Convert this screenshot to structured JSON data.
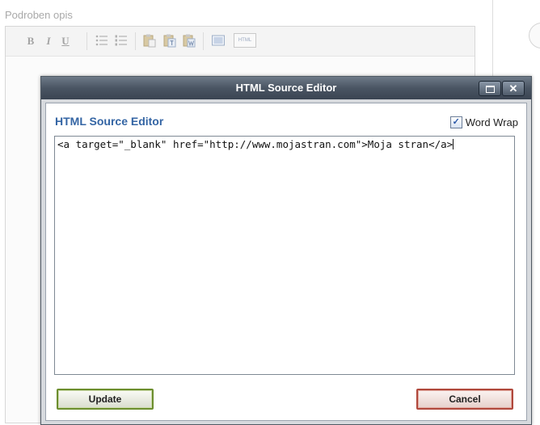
{
  "background": {
    "field_label": "Podroben opis",
    "toolbar": {
      "bold": "B",
      "italic": "I",
      "underline": "U",
      "html_button": "HTML"
    }
  },
  "dialog": {
    "title": "HTML Source Editor",
    "heading": "HTML Source Editor",
    "word_wrap_label": "Word Wrap",
    "word_wrap_checked": true,
    "source": "<a target=\"_blank\" href=\"http://www.mojastran.com\">Moja stran</a>",
    "update_label": "Update",
    "cancel_label": "Cancel"
  },
  "colors": {
    "heading": "#3465a4",
    "titlebar": "#4a5563",
    "update_border": "#6c8e2e",
    "cancel_border": "#b0483c"
  },
  "icons": [
    "bullet-list-icon",
    "numbered-list-icon",
    "paste-icon",
    "paste-text-icon",
    "paste-word-icon",
    "table-icon",
    "checkmark-icon",
    "minimize-icon",
    "close-icon"
  ]
}
